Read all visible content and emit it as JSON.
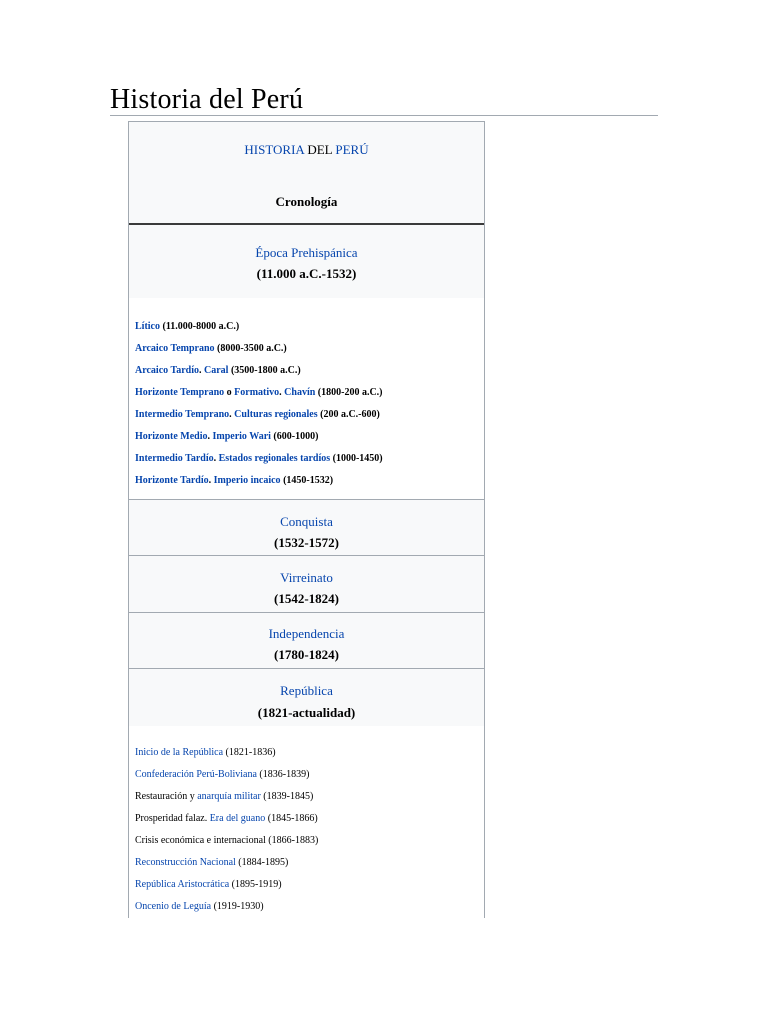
{
  "page": {
    "title": "Historia del Perú"
  },
  "infobox": {
    "header": {
      "word1": "HISTORIA",
      "word2": " DEL ",
      "word3": "PERÚ",
      "subtitle": "Cronología"
    },
    "prehispanic": {
      "title": "Época Prehispánica",
      "dates": "(11.000 a.C.-1532)",
      "items": [
        {
          "l1": "Lítico",
          "t1": " (11.000-8000 a.C.)"
        },
        {
          "l1": "Arcaico Temprano",
          "t1": " (8000-3500 a.C.)"
        },
        {
          "l1": "Arcaico Tardío",
          "t1": ". ",
          "l2": "Caral",
          "t2": " (3500-1800 a.C.)"
        },
        {
          "l1": "Horizonte Temprano",
          "t1": " o ",
          "l2": "Formativo",
          "t2": ". ",
          "l3": "Chavín",
          "t3": " (1800-200 a.C.)"
        },
        {
          "l1": "Intermedio Temprano",
          "t1": ". ",
          "l2": "Culturas regionales",
          "t2": " (200 a.C.-600)"
        },
        {
          "l1": "Horizonte Medio",
          "t1": ". ",
          "l2": "Imperio Wari",
          "t2": " (600-1000)"
        },
        {
          "l1": "Intermedio Tardío",
          "t1": ". ",
          "l2": "Estados regionales tardíos",
          "t2": " (1000-1450)"
        },
        {
          "l1": "Horizonte Tardío",
          "t1": ". ",
          "l2": "Imperio incaico",
          "t2": " (1450-1532)"
        }
      ]
    },
    "conquista": {
      "title": "Conquista",
      "dates": "(1532-1572)"
    },
    "virreinato": {
      "title": "Virreinato",
      "dates": "(1542-1824)"
    },
    "independencia": {
      "title": "Independencia",
      "dates": "(1780-1824)"
    },
    "republica": {
      "title": "República",
      "dates": "(1821-actualidad)",
      "items": [
        {
          "l1": "Inicio de la República",
          "t1": " (1821-1836)"
        },
        {
          "l1": "Confederación Perú-Boliviana",
          "t1": " (1836-1839)"
        },
        {
          "p0": "Restauración y ",
          "l1": "anarquía militar",
          "t1": " (1839-1845)"
        },
        {
          "p0": "Prosperidad falaz. ",
          "l1": "Era del guano",
          "t1": " (1845-1866)"
        },
        {
          "p0": "Crisis económica e internacional (1866-1883)"
        },
        {
          "l1": "Reconstrucción Nacional",
          "t1": " (1884-1895)"
        },
        {
          "l1": "República Aristocrática",
          "t1": " (1895-1919)"
        },
        {
          "l1": "Oncenio de Leguía",
          "t1": " (1919-1930)"
        }
      ]
    }
  }
}
